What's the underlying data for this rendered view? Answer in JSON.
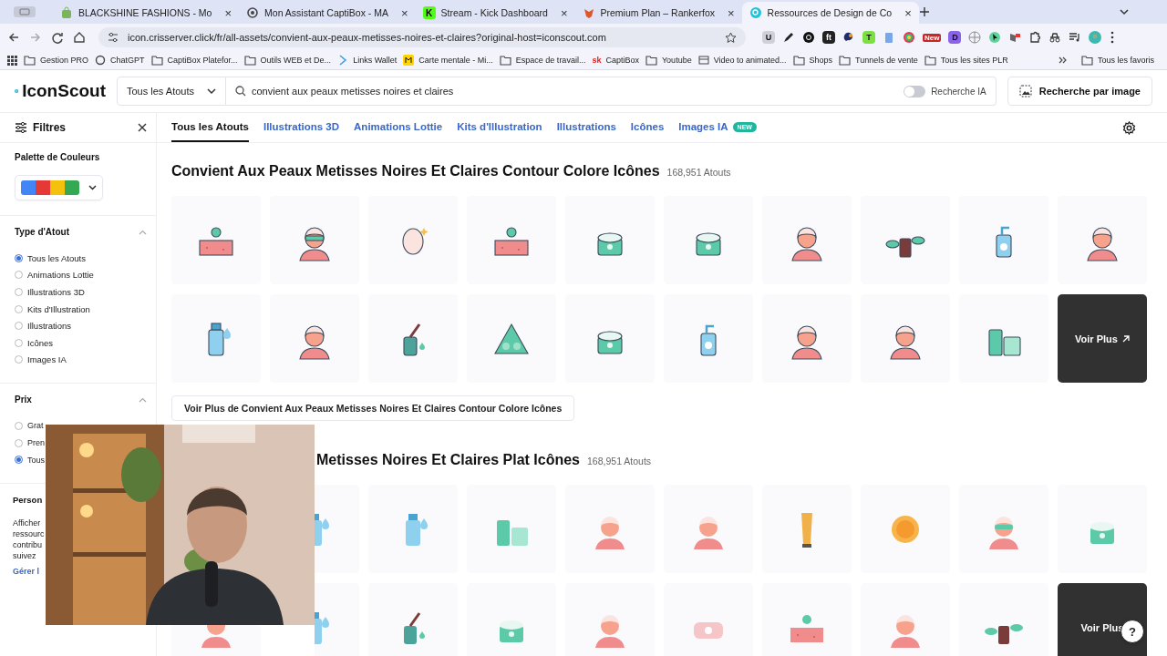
{
  "browser": {
    "tabs": [
      {
        "title": "BLACKSHINE FASHIONS - Mo",
        "selected": false,
        "kind": "bag",
        "close": "×"
      },
      {
        "title": "Mon Assistant CaptiBox - MA",
        "selected": false,
        "kind": "knot",
        "close": "×"
      },
      {
        "title": "Stream - Kick Dashboard",
        "selected": false,
        "kind": "letter",
        "glyph": "K",
        "close": "×"
      },
      {
        "title": "Premium Plan – Rankerfox",
        "selected": false,
        "kind": "fox",
        "close": "×"
      },
      {
        "title": "Ressources de Design de Co",
        "selected": true,
        "kind": "search",
        "close": "×"
      }
    ],
    "url": "icon.crisserver.click/fr/all-assets/convient-aux-peaux-metisses-noires-et-claires?original-host=iconscout.com",
    "extensions": [
      {
        "kind": "letter",
        "glyph": "U",
        "color": "#d0d0d8"
      },
      {
        "kind": "pen"
      },
      {
        "kind": "ring"
      },
      {
        "kind": "letter",
        "glyph": "ft",
        "color": "#222222"
      },
      {
        "kind": "swirl"
      },
      {
        "kind": "letter",
        "glyph": "T",
        "color": "#7be042"
      },
      {
        "kind": "clip"
      },
      {
        "kind": "multi"
      },
      {
        "kind": "badge",
        "text": "New"
      },
      {
        "kind": "letter",
        "glyph": "D",
        "color": "#8a63e8"
      },
      {
        "kind": "globe"
      },
      {
        "kind": "cursor"
      },
      {
        "kind": "flag"
      },
      {
        "kind": "puzzle"
      },
      {
        "kind": "spy"
      },
      {
        "kind": "playlist"
      },
      {
        "kind": "avatar"
      }
    ],
    "bookmarks": [
      {
        "label": "Gestion PRO",
        "kind": "folder"
      },
      {
        "label": "ChatGPT",
        "kind": "knot"
      },
      {
        "label": "CaptiBox Platefor...",
        "kind": "folder"
      },
      {
        "label": "Outils WEB et De...",
        "kind": "folder"
      },
      {
        "label": "Links Wallet",
        "kind": "wallet"
      },
      {
        "label": "Carte mentale - Mi...",
        "kind": "map"
      },
      {
        "label": "Espace de travail...",
        "kind": "folder"
      },
      {
        "label": "CaptiBox",
        "kind": "letter",
        "glyph": "sk"
      },
      {
        "label": "Youtube",
        "kind": "folder"
      },
      {
        "label": "Video to animated...",
        "kind": "film"
      },
      {
        "label": "Shops",
        "kind": "folder"
      },
      {
        "label": "Tunnels de vente",
        "kind": "folder"
      },
      {
        "label": "Tous les sites PLR",
        "kind": "folder"
      }
    ],
    "all_bookmarks": "Tous les favoris"
  },
  "header": {
    "logo": "IconScout",
    "category": "Tous les Atouts",
    "search": "convient aux peaux metisses noires et claires",
    "ai_toggle": {
      "label": "Recherche IA",
      "on": false
    },
    "image_search": "Recherche par image"
  },
  "filters": {
    "title": "Filtres"
  },
  "asset_tabs": [
    {
      "label": "Tous les Atouts",
      "selected": true
    },
    {
      "label": "Illustrations 3D",
      "selected": false
    },
    {
      "label": "Animations Lottie",
      "selected": false
    },
    {
      "label": "Kits d'Illustration",
      "selected": false
    },
    {
      "label": "Illustrations",
      "selected": false
    },
    {
      "label": "Icônes",
      "selected": false
    },
    {
      "label": "Images IA",
      "selected": false,
      "badge": "NEW"
    }
  ],
  "sidebar": [
    {
      "kind": "palette",
      "title": "Palette de Couleurs",
      "swatches": [
        {
          "color": "#4285f4"
        },
        {
          "color": "#e53935"
        },
        {
          "color": "#f4c20d"
        },
        {
          "color": "#34a853"
        }
      ]
    },
    {
      "kind": "radios",
      "title": "Type d'Atout",
      "expanded": true,
      "options": [
        {
          "label": "Tous les Atouts",
          "selected": true
        },
        {
          "label": "Animations Lottie",
          "selected": false
        },
        {
          "label": "Illustrations 3D",
          "selected": false
        },
        {
          "label": "Kits d'Illustration",
          "selected": false
        },
        {
          "label": "Illustrations",
          "selected": false
        },
        {
          "label": "Icônes",
          "selected": false
        },
        {
          "label": "Images IA",
          "selected": false
        }
      ]
    },
    {
      "kind": "radios",
      "title": "Prix",
      "expanded": true,
      "options": [
        {
          "label": "Grat",
          "selected": false
        },
        {
          "label": "Pren",
          "selected": false
        },
        {
          "label": "Tous",
          "selected": true
        }
      ]
    },
    {
      "kind": "text",
      "title": "Person",
      "lines": [
        "Afficher",
        "ressourc",
        "contribu",
        "suivez"
      ],
      "link": "Gérer l"
    }
  ],
  "sections": [
    {
      "title": "Convient Aux Peaux Metisses Noires Et Claires Contour Colore Icônes",
      "count": "168,951 Atouts",
      "tiles": [
        {
          "kind": "skin"
        },
        {
          "kind": "sleep"
        },
        {
          "kind": "mask"
        },
        {
          "kind": "skin"
        },
        {
          "kind": "jar"
        },
        {
          "kind": "jar"
        },
        {
          "kind": "woman"
        },
        {
          "kind": "plant"
        },
        {
          "kind": "pump"
        },
        {
          "kind": "woman"
        },
        {
          "kind": "bottle"
        },
        {
          "kind": "woman"
        },
        {
          "kind": "dropper"
        },
        {
          "kind": "triangle"
        },
        {
          "kind": "jar"
        },
        {
          "kind": "pump"
        },
        {
          "kind": "woman"
        },
        {
          "kind": "woman"
        },
        {
          "kind": "bottles"
        },
        {
          "kind": "more",
          "label": "Voir Plus"
        }
      ],
      "see_all": "Voir Plus de Convient Aux Peaux Metisses Noires Et Claires Contour Colore Icônes"
    },
    {
      "title": "Metisses Noires Et Claires Plat Icônes",
      "count": "168,951 Atouts",
      "tiles": [
        {
          "kind": "bottle"
        },
        {
          "kind": "bottle"
        },
        {
          "kind": "bottles"
        },
        {
          "kind": "woman"
        },
        {
          "kind": "woman"
        },
        {
          "kind": "tube"
        },
        {
          "kind": "sun"
        },
        {
          "kind": "sleep"
        },
        {
          "kind": "jar"
        },
        {
          "kind": "woman"
        },
        {
          "kind": "bottle"
        },
        {
          "kind": "dropper"
        },
        {
          "kind": "jar"
        },
        {
          "kind": "woman"
        },
        {
          "kind": "soap"
        },
        {
          "kind": "skin"
        },
        {
          "kind": "woman"
        },
        {
          "kind": "plant"
        },
        {
          "kind": "more",
          "label": "Voir Plus"
        }
      ]
    }
  ],
  "help": "?"
}
